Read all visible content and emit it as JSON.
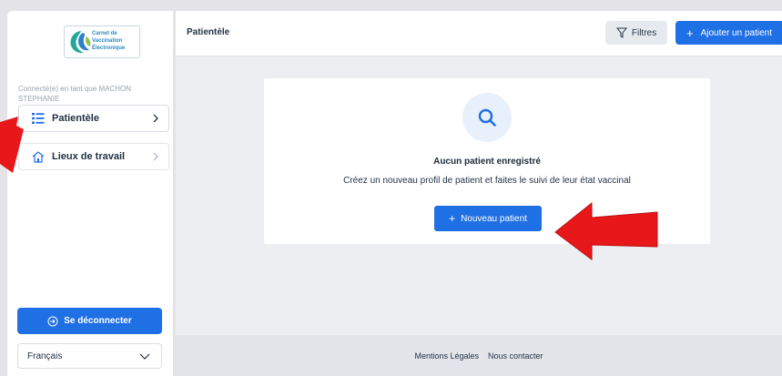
{
  "logo": {
    "line1": "Carnet de",
    "line2": "Vaccination",
    "line3": "Électronique"
  },
  "sidebar": {
    "connected_text": "Connecté(e) en tant que MACHON STEPHANIE",
    "items": [
      {
        "label": "Patientèle",
        "icon": "list-icon"
      },
      {
        "label": "Lieux de travail",
        "icon": "home-icon"
      }
    ],
    "logout_label": "Se déconnecter",
    "language": "Français"
  },
  "header": {
    "title": "Patientèle",
    "filter_label": "Filtres",
    "add_label": "Ajouter un patient"
  },
  "empty_state": {
    "title": "Aucun patient enregistré",
    "description": "Créez un nouveau profil de patient et faites le suivi de leur état vaccinal",
    "button_label": "Nouveau patient"
  },
  "footer": {
    "legal_link": "Mentions Légales",
    "contact_link": "Nous contacter"
  },
  "colors": {
    "primary": "#1f6fe5",
    "annotation_arrow": "#e8171a"
  }
}
